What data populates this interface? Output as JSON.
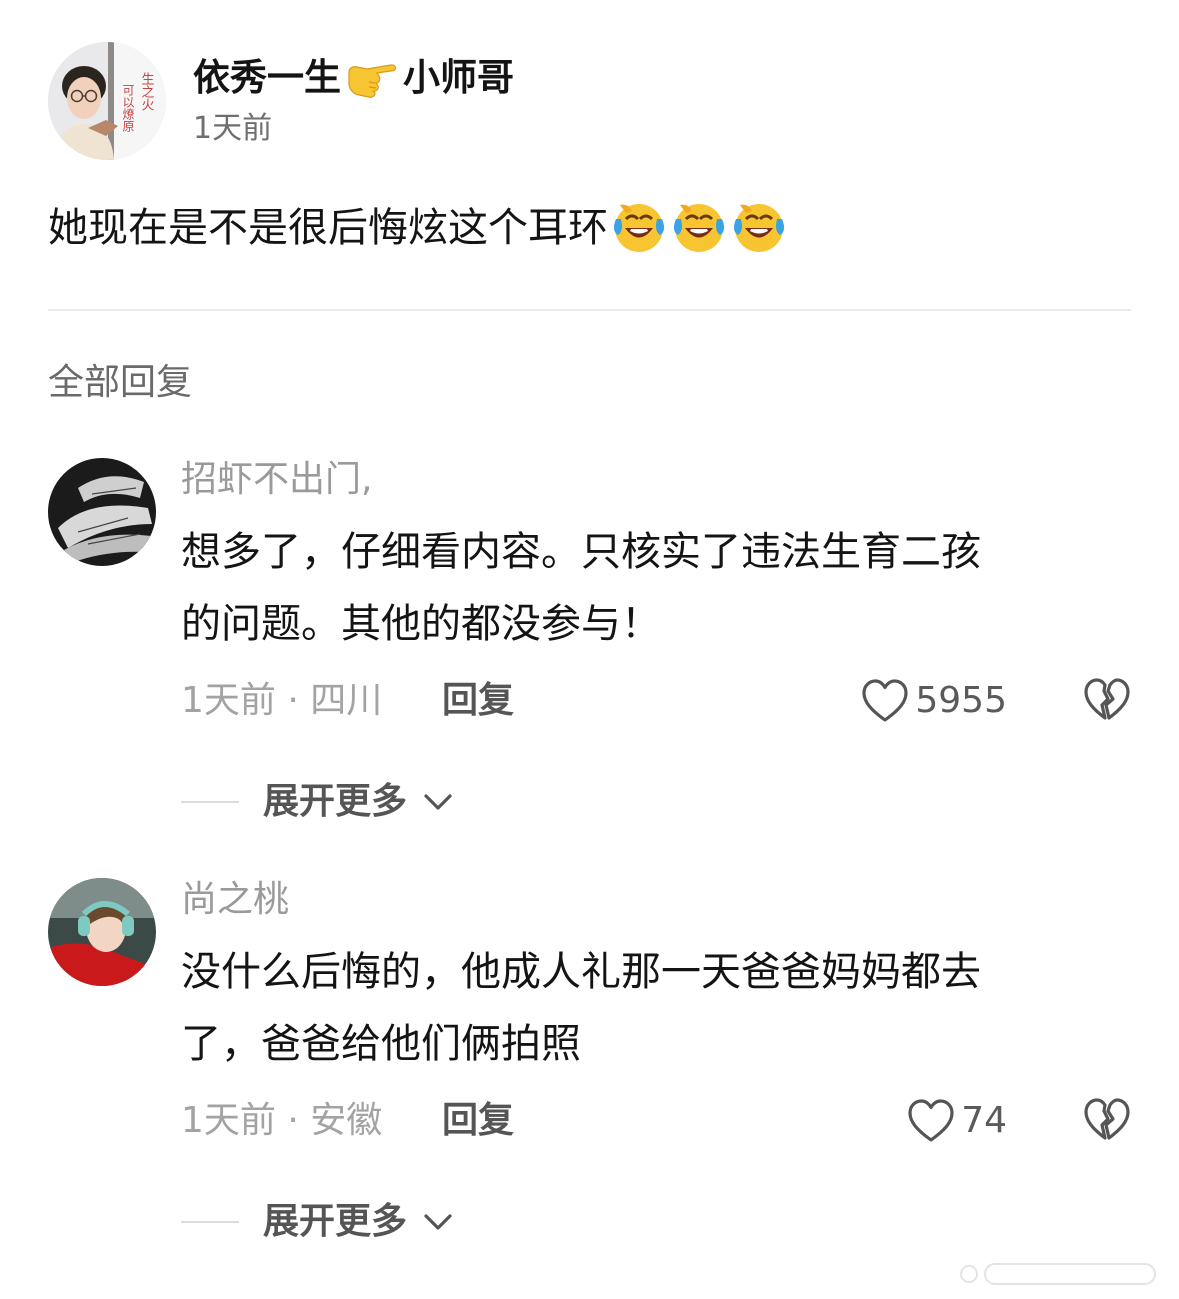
{
  "post": {
    "author": {
      "name_before": "依秀一生",
      "name_after": "小师哥",
      "emoji_icon": "pointing-hand-icon",
      "avatar_text_1": "生之火",
      "avatar_text_2": "可以燎原"
    },
    "time": "1天前",
    "text": "她现在是不是很后悔炫这个耳环",
    "emoji_icon": "laughing-crying-emoji",
    "emoji_count": 3
  },
  "section_title": "全部回复",
  "comments": [
    {
      "username": "招虾不出门,",
      "lines": [
        "想多了，仔细看内容。只核实了违法生育二孩",
        "的问题。其他的都没参与！"
      ],
      "time_location": "1天前 · 四川",
      "reply_label": "回复",
      "likes": "5955",
      "expand_label": "展开更多"
    },
    {
      "username": "尚之桃",
      "lines": [
        "没什么后悔的，他成人礼那一天爸爸妈妈都去",
        "了，爸爸给他们俩拍照"
      ],
      "time_location": "1天前 · 安徽",
      "reply_label": "回复",
      "likes": "74",
      "expand_label": "展开更多"
    }
  ],
  "colors": {
    "text_primary": "#141414",
    "text_secondary": "#9a9a9a",
    "divider": "#ebebeb",
    "emoji_yellow": "#f7c531",
    "emoji_tear": "#3aa3e6"
  }
}
